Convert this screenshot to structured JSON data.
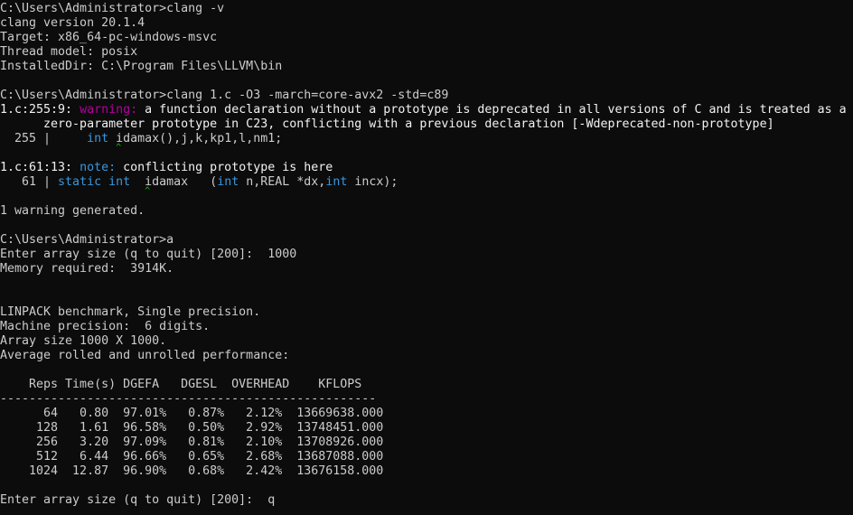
{
  "window": {
    "kind": "command-prompt"
  },
  "lines": [
    [
      {
        "t": "C:\\Users\\Administrator>clang -v",
        "c": "default"
      }
    ],
    [
      {
        "t": "clang version 20.1.4",
        "c": "default"
      }
    ],
    [
      {
        "t": "Target: x86_64-pc-windows-msvc",
        "c": "default"
      }
    ],
    [
      {
        "t": "Thread model: posix",
        "c": "default"
      }
    ],
    [
      {
        "t": "InstalledDir: C:\\Program Files\\LLVM\\bin",
        "c": "default"
      }
    ],
    [],
    [
      {
        "t": "C:\\Users\\Administrator>clang 1.c -O3 -march=core-avx2 -std=c89",
        "c": "default"
      }
    ],
    [
      {
        "t": "1.c:255:9: ",
        "c": "bold"
      },
      {
        "t": "warning: ",
        "c": "magenta"
      },
      {
        "t": "a function declaration without a prototype is deprecated in all versions of C and is treated as a",
        "c": "bold"
      }
    ],
    [
      {
        "t": "      zero-parameter prototype in C23, conflicting with a previous declaration [-Wdeprecated-non-prototype]",
        "c": "bold"
      }
    ],
    [
      {
        "t": "  255 |     ",
        "c": "default"
      },
      {
        "t": "int",
        "c": "cyan"
      },
      {
        "t": " ",
        "c": "default"
      },
      {
        "t": "idamax(),j,k,kp1,l,nm1;",
        "c": "default",
        "caret": true
      }
    ],
    [],
    [
      {
        "t": "1.c:61:13: ",
        "c": "bold"
      },
      {
        "t": "note: ",
        "c": "cyan"
      },
      {
        "t": "conflicting prototype is here",
        "c": "bold"
      }
    ],
    [
      {
        "t": "   61 | ",
        "c": "default"
      },
      {
        "t": "static",
        "c": "cyan"
      },
      {
        "t": " ",
        "c": "default"
      },
      {
        "t": "int",
        "c": "cyan"
      },
      {
        "t": "  ",
        "c": "default"
      },
      {
        "t": "idamax   (",
        "c": "default",
        "caret": true
      },
      {
        "t": "int",
        "c": "cyan"
      },
      {
        "t": " n,REAL *dx,",
        "c": "default"
      },
      {
        "t": "int",
        "c": "cyan"
      },
      {
        "t": " incx);",
        "c": "default"
      }
    ],
    [],
    [
      {
        "t": "1 warning generated.",
        "c": "default"
      }
    ],
    [],
    [
      {
        "t": "C:\\Users\\Administrator>a",
        "c": "default"
      }
    ],
    [
      {
        "t": "Enter array size (q to quit) [200]:  1000",
        "c": "default"
      }
    ],
    [
      {
        "t": "Memory required:  3914K.",
        "c": "default"
      }
    ],
    [],
    [],
    [
      {
        "t": "LINPACK benchmark, Single precision.",
        "c": "default"
      }
    ],
    [
      {
        "t": "Machine precision:  6 digits.",
        "c": "default"
      }
    ],
    [
      {
        "t": "Array size 1000 X 1000.",
        "c": "default"
      }
    ],
    [
      {
        "t": "Average rolled and unrolled performance:",
        "c": "default"
      }
    ],
    [],
    [
      {
        "t": "    Reps Time(s) DGEFA   DGESL  OVERHEAD    KFLOPS",
        "c": "default"
      }
    ],
    [
      {
        "t": "----------------------------------------------------",
        "c": "default"
      }
    ],
    [
      {
        "t": "      64   0.80  97.01%   0.87%   2.12%  13669638.000",
        "c": "default"
      }
    ],
    [
      {
        "t": "     128   1.61  96.58%   0.50%   2.92%  13748451.000",
        "c": "default"
      }
    ],
    [
      {
        "t": "     256   3.20  97.09%   0.81%   2.10%  13708926.000",
        "c": "default"
      }
    ],
    [
      {
        "t": "     512   6.44  96.66%   0.65%   2.68%  13687088.000",
        "c": "default"
      }
    ],
    [
      {
        "t": "    1024  12.87  96.90%   0.68%   2.42%  13676158.000",
        "c": "default"
      }
    ],
    [],
    [
      {
        "t": "Enter array size (q to quit) [200]:  q",
        "c": "default"
      }
    ]
  ],
  "colors": {
    "background": "#0c0c0c",
    "foreground": "#cccccc",
    "bold": "#f2f2f2",
    "magenta": "#b4009e",
    "cyan": "#3a96dd",
    "green": "#16c60c"
  }
}
